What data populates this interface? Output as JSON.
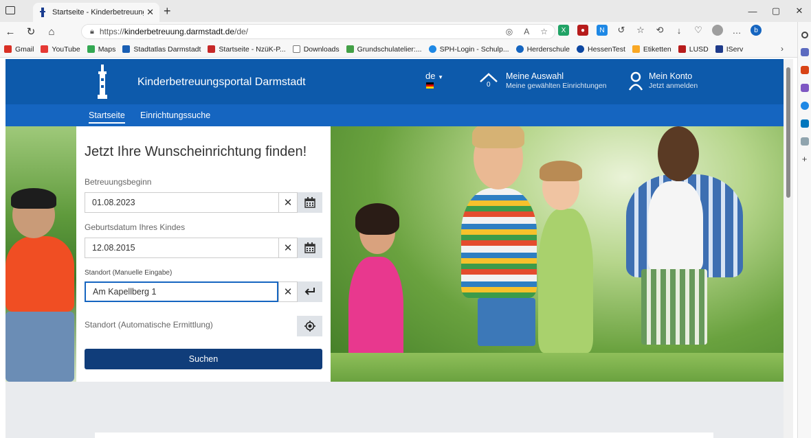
{
  "browser": {
    "tab_title": "Startseite - Kinderbetreuungspor",
    "url_host_prefix": "https://",
    "url_host": "kinderbetreuung.darmstadt.de",
    "url_path": "/de/",
    "bookmarks": [
      {
        "label": "Gmail",
        "color": "#d93025"
      },
      {
        "label": "YouTube",
        "color": "#e53935"
      },
      {
        "label": "Maps",
        "color": "#34a853"
      },
      {
        "label": "Stadtatlas Darmstadt",
        "color": "#1a5fb4"
      },
      {
        "label": "Startseite - NzüK-P...",
        "color": "#c62828"
      },
      {
        "label": "Downloads",
        "color": "#777777"
      },
      {
        "label": "Grundschulatelier:...",
        "color": "#43a047"
      },
      {
        "label": "SPH-Login - Schulp...",
        "color": "#1e88e5"
      },
      {
        "label": "Herderschule",
        "color": "#1565c0"
      },
      {
        "label": "HessenTest",
        "color": "#0d47a1"
      },
      {
        "label": "Etiketten",
        "color": "#f9a825"
      },
      {
        "label": "LUSD",
        "color": "#b71c1c"
      },
      {
        "label": "IServ",
        "color": "#1e3a8a"
      }
    ]
  },
  "header": {
    "portal_title": "Kinderbetreuungsportal Darmstadt",
    "language": "de",
    "my_selection_title": "Meine Auswahl",
    "my_selection_sub": "Meine gewählten Einrichtungen",
    "my_selection_count": "0",
    "account_title": "Mein Konto",
    "account_sub": "Jetzt anmelden"
  },
  "nav": {
    "items": [
      "Startseite",
      "Einrichtungssuche"
    ]
  },
  "search": {
    "title": "Jetzt Ihre Wunscheinrichtung finden!",
    "start_label": "Betreuungsbeginn",
    "start_value": "01.08.2023",
    "birth_label": "Geburtsdatum Ihres Kindes",
    "birth_value": "12.08.2015",
    "location_manual_label": "Standort (Manuelle Eingabe)",
    "location_manual_value": "Am Kapellberg 1",
    "location_auto_label": "Standort (Automatische Ermittlung)",
    "submit_label": "Suchen"
  },
  "colors": {
    "header_blue": "#0d5aab",
    "nav_blue": "#1565c0",
    "button_dark": "#103d7a"
  }
}
